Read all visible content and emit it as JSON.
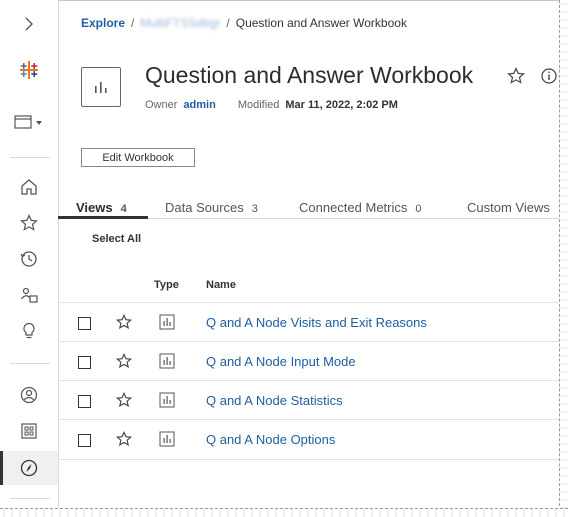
{
  "breadcrumb": {
    "root": "Explore",
    "separator": "/",
    "project_obscured": "MultiFTSSdbgr",
    "current": "Question and Answer Workbook"
  },
  "workbook": {
    "title": "Question and Answer Workbook",
    "owner_label": "Owner",
    "owner_value": "admin",
    "modified_label": "Modified",
    "modified_value": "Mar 11, 2022, 2:02 PM",
    "edit_button": "Edit Workbook"
  },
  "tabs": [
    {
      "label": "Views",
      "count": "4",
      "active": true
    },
    {
      "label": "Data Sources",
      "count": "3",
      "active": false
    },
    {
      "label": "Connected Metrics",
      "count": "0",
      "active": false
    },
    {
      "label": "Custom Views",
      "count": "",
      "active": false
    }
  ],
  "list": {
    "select_all": "Select All",
    "columns": {
      "type": "Type",
      "name": "Name"
    },
    "rows": [
      {
        "name": "Q and A Node Visits and Exit Reasons"
      },
      {
        "name": "Q and A Node Input Mode"
      },
      {
        "name": "Q and A Node Statistics"
      },
      {
        "name": "Q and A Node Options"
      }
    ]
  },
  "sidebar": {
    "icons": [
      "chevron-right-icon",
      "tableau-logo-icon",
      "site-switcher-icon",
      "home-icon",
      "favorites-icon",
      "recents-icon",
      "shared-with-me-icon",
      "recommendations-icon",
      "personal-space-icon",
      "collections-icon",
      "explore-icon"
    ]
  },
  "colors": {
    "link": "#1f5fa0",
    "text": "#333333",
    "border": "#d9d9d9"
  }
}
